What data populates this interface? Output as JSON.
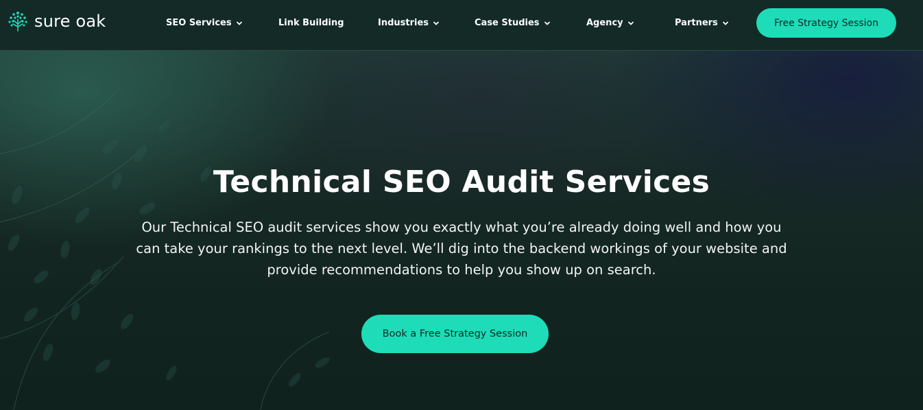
{
  "brand": {
    "name": "sure oak",
    "logo_icon": "tree-icon",
    "accent_color": "#1edcb7",
    "header_bg": "#132a27"
  },
  "nav": {
    "items": [
      {
        "label": "SEO Services",
        "has_dropdown": true
      },
      {
        "label": "Link Building",
        "has_dropdown": false
      },
      {
        "label": "Industries",
        "has_dropdown": true
      },
      {
        "label": "Case Studies",
        "has_dropdown": true
      },
      {
        "label": "Agency",
        "has_dropdown": true
      },
      {
        "label": "Partners",
        "has_dropdown": true
      }
    ],
    "cta_label": "Free Strategy Session"
  },
  "hero": {
    "title": "Technical SEO Audit Services",
    "description": "Our Technical SEO audit services show you exactly what you’re already doing well and how you can take your rankings to the next level. We’ll dig into the backend workings of your website and provide recommendations to help you show up on search.",
    "cta_label": "Book a Free Strategy Session",
    "background_icon": "leaf-pattern-icon"
  }
}
